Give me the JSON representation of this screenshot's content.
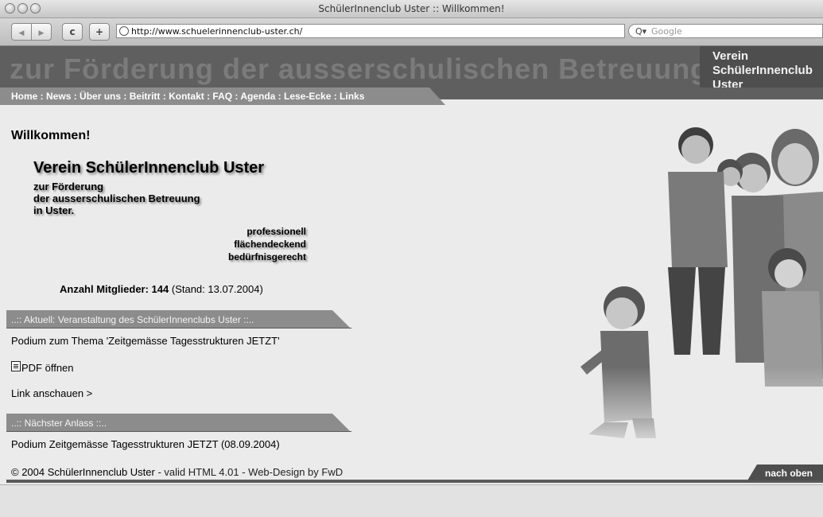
{
  "window": {
    "title": "SchülerInnenclub Uster :: Willkommen!"
  },
  "toolbar": {
    "back_label": "◀",
    "forward_label": "▶",
    "reload_label": "c",
    "add_label": "+",
    "url": "http://www.schuelerinnenclub-uster.ch/",
    "search_placeholder": "Google"
  },
  "header": {
    "banner_text": "zur Förderung der ausserschulischen Betreuung in Uster",
    "brand_line1": "Verein",
    "brand_line2": "SchülerInnenclub",
    "brand_line3": "Uster"
  },
  "nav": {
    "items": [
      "Home",
      "News",
      "Über uns",
      "Beitritt",
      "Kontakt",
      "FAQ",
      "Agenda",
      "Lese-Ecke",
      "Links"
    ],
    "separator": " : "
  },
  "main": {
    "welcome": "Willkommen!",
    "logo_title": "Verein SchülerInnenclub Uster",
    "logo_lines": [
      "zur Förderung",
      "der ausserschulischen Betreuung",
      "in Uster."
    ],
    "slogans": [
      "professionell",
      "flächendeckend",
      "bedürfnisgerecht"
    ],
    "members_label": "Anzahl Mitglieder: 144",
    "members_stand": " (Stand: 13.07.2004)"
  },
  "aktuell": {
    "heading": "..:: Aktuell: Veranstaltung des SchülerInnenclubs Uster ::..",
    "text": "Podium zum Thema 'Zeitgemässe Tagesstrukturen JETZT'",
    "pdf_link": "PDF öffnen",
    "view_link": "Link anschauen >"
  },
  "next_event": {
    "heading": "..:: Nächster Anlass ::..",
    "text": "Podium Zeitgemässe Tagesstrukturen JETZT (08.09.2004)"
  },
  "footer": {
    "copyright": "© 2004 SchülerInnenclub Uster",
    "dash1": " - ",
    "valid": "valid HTML 4.01",
    "dash2": " - ",
    "design": "Web-Design by FwD",
    "top_link": "nach oben"
  }
}
